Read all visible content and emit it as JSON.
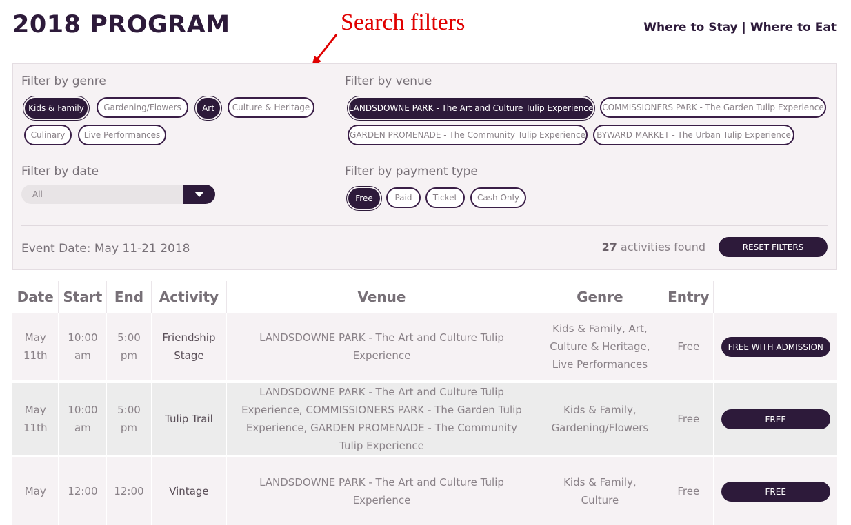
{
  "header": {
    "title": "2018 PROGRAM",
    "links": [
      "Where to Stay",
      "Where to Eat"
    ],
    "separator": "|"
  },
  "annotation": {
    "text": "Search filters",
    "color": "#e00000"
  },
  "filters": {
    "genre": {
      "heading": "Filter by genre",
      "options": [
        {
          "label": "Kids & Family",
          "active": true
        },
        {
          "label": "Gardening/Flowers",
          "active": false
        },
        {
          "label": "Art",
          "active": true
        },
        {
          "label": "Culture & Heritage",
          "active": false
        },
        {
          "label": "Culinary",
          "active": false
        },
        {
          "label": "Live Performances",
          "active": false
        }
      ]
    },
    "venue": {
      "heading": "Filter by venue",
      "options": [
        {
          "label": "LANDSDOWNE PARK - The Art and Culture Tulip Experience",
          "active": true
        },
        {
          "label": "COMMISSIONERS PARK - The Garden Tulip Experience",
          "active": false
        },
        {
          "label": "GARDEN PROMENADE - The Community Tulip Experience",
          "active": false
        },
        {
          "label": "BYWARD MARKET - The Urban Tulip Experience",
          "active": false
        }
      ]
    },
    "date": {
      "heading": "Filter by date",
      "selected": "All"
    },
    "payment": {
      "heading": "Filter by payment type",
      "options": [
        {
          "label": "Free",
          "active": true
        },
        {
          "label": "Paid",
          "active": false
        },
        {
          "label": "Ticket",
          "active": false
        },
        {
          "label": "Cash Only",
          "active": false
        }
      ]
    },
    "event_date": "Event Date: May 11-21 2018",
    "found_count": "27",
    "found_text": "activities found",
    "reset_label": "RESET FILTERS"
  },
  "table": {
    "headers": [
      "Date",
      "Start",
      "End",
      "Activity",
      "Venue",
      "Genre",
      "Entry",
      ""
    ],
    "rows": [
      {
        "date": "May 11th",
        "start": "10:00 am",
        "end": "5:00 pm",
        "activity": "Friendship Stage",
        "venue": "LANDSDOWNE PARK - The Art and Culture Tulip Experience",
        "genre": "Kids & Family, Art, Culture & Heritage, Live Performances",
        "entry": "Free",
        "action": "FREE WITH ADMISSION"
      },
      {
        "date": "May 11th",
        "start": "10:00 am",
        "end": "5:00 pm",
        "activity": "Tulip Trail",
        "venue": "LANDSDOWNE PARK - The Art and Culture Tulip Experience, COMMISSIONERS PARK - The Garden Tulip Experience, GARDEN PROMENADE - The Community Tulip Experience",
        "genre": "Kids & Family, Gardening/Flowers",
        "entry": "Free",
        "action": "FREE"
      },
      {
        "date": "May",
        "start": "12:00",
        "end": "12:00",
        "activity": "Vintage",
        "venue": "LANDSDOWNE PARK - The Art and Culture Tulip Experience",
        "genre": "Kids & Family, Culture",
        "entry": "Free",
        "action": "FREE"
      }
    ]
  },
  "colors": {
    "brand": "#2d1a3a",
    "panel": "#f6f2f4"
  }
}
